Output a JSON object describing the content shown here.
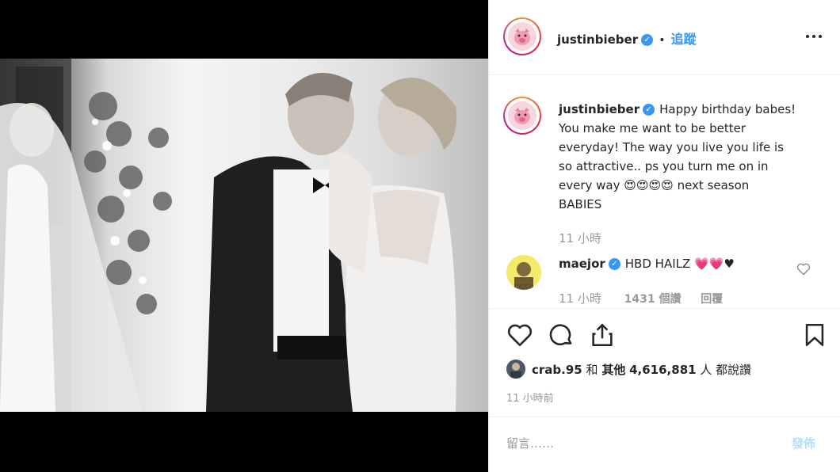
{
  "post": {
    "username": "justinbieber",
    "dot": "•",
    "follow_label": "追蹤",
    "more_icon": "more-icon"
  },
  "caption": {
    "username": "justinbieber",
    "text_lines": [
      "Happy birthday babes!",
      "You make me want to be better",
      "everyday! The way you live you life is",
      "so attractive.. ps you turn me on in",
      "every way 😍😍😍😍 next season",
      "BABIES"
    ],
    "time": "11 小時"
  },
  "comment": {
    "username": "maejor",
    "text": "HBD HAILZ 💗💗♥",
    "time": "11 小時",
    "likes": "1431 個讚",
    "reply_label": "回覆"
  },
  "likes": {
    "liker": "crab.95",
    "and": "和",
    "others_label": "其他",
    "count": "4,616,881",
    "suffix": "人 都說讚"
  },
  "timestamp": "11 小時前",
  "composer": {
    "placeholder": "留言……",
    "post_label": "發佈"
  },
  "colors": {
    "verified": "#3897f0",
    "follow": "#3897f0",
    "post_disabled": "#b2dffc"
  }
}
